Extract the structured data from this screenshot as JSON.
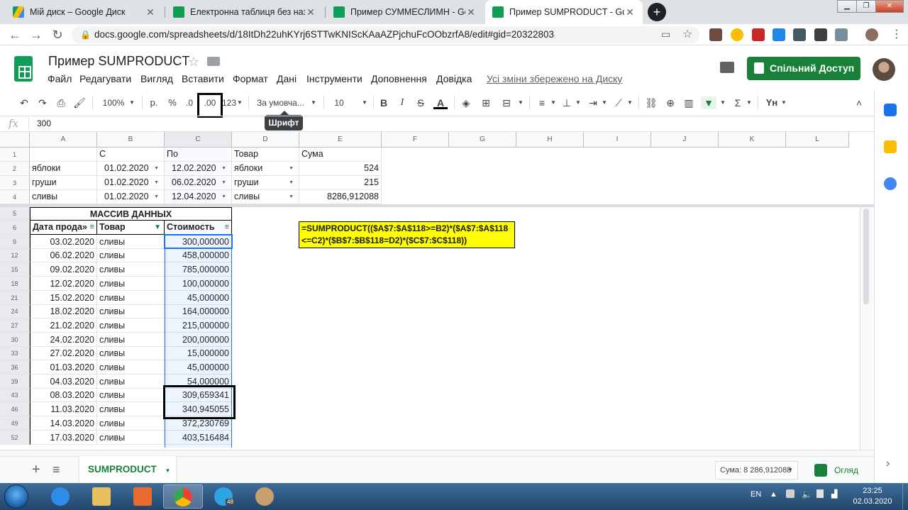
{
  "browser": {
    "tabs": [
      {
        "title": "Мій диск – Google Диск",
        "color": "#fbbc04"
      },
      {
        "title": "Електронна таблиця без назви",
        "color": "#0f9d58"
      },
      {
        "title": "Пример СУММЕСЛИМН - Goog",
        "color": "#0f9d58"
      },
      {
        "title": "Пример SUMPRODUCT - Google",
        "color": "#0f9d58"
      }
    ],
    "new_tab": "+",
    "url": "docs.google.com/spreadsheets/d/18ItDh22uhKYrj6STTwKNIScKAaAZPjchuFcOObzrfA8/edit#gid=20322803"
  },
  "sheets": {
    "title": "Пример SUMPRODUCT",
    "menu": [
      "Файл",
      "Редагувати",
      "Вигляд",
      "Вставити",
      "Формат",
      "Дані",
      "Інструменти",
      "Доповнення",
      "Довідка"
    ],
    "saved_message": "Усі зміни збережено на Диску",
    "share_label": "Спільний Доступ"
  },
  "toolbar": {
    "zoom": "100%",
    "currency": "р.",
    "percent": "%",
    "dec_decrease": ".0",
    "dec_increase": ".00",
    "more_formats": "123",
    "font": "За умовча...",
    "font_size": "10",
    "bold": "B",
    "italic": "I",
    "strike": "S",
    "text_color": "A",
    "tooltip": "Шрифт"
  },
  "formula_bar": {
    "fx": "fx",
    "value": "300"
  },
  "columns": [
    "A",
    "B",
    "C",
    "D",
    "E",
    "F",
    "G",
    "H",
    "I",
    "J",
    "K",
    "L"
  ],
  "criteria": {
    "header": {
      "c": "С",
      "po": "По",
      "tovar": "Товар",
      "suma": "Сума"
    },
    "rows": [
      {
        "row": "2",
        "name": "яблоки",
        "from": "01.02.2020",
        "to": "12.02.2020",
        "product": "яблоки",
        "sum": "524"
      },
      {
        "row": "3",
        "name": "груши",
        "from": "01.02.2020",
        "to": "06.02.2020",
        "product": "груши",
        "sum": "215"
      },
      {
        "row": "4",
        "name": "сливы",
        "from": "01.02.2020",
        "to": "12.04.2020",
        "product": "сливы",
        "sum": "8286,912088"
      }
    ]
  },
  "dataset": {
    "title": "МАССИВ ДАННЫХ",
    "headers": {
      "date": "Дата прода»",
      "product": "Товар",
      "cost": "Стоимость"
    },
    "rows": [
      {
        "row": "9",
        "date": "03.02.2020",
        "product": "сливы",
        "cost": "300,000000"
      },
      {
        "row": "12",
        "date": "06.02.2020",
        "product": "сливы",
        "cost": "458,000000"
      },
      {
        "row": "15",
        "date": "09.02.2020",
        "product": "сливы",
        "cost": "785,000000"
      },
      {
        "row": "18",
        "date": "12.02.2020",
        "product": "сливы",
        "cost": "100,000000"
      },
      {
        "row": "21",
        "date": "15.02.2020",
        "product": "сливы",
        "cost": "45,000000"
      },
      {
        "row": "24",
        "date": "18.02.2020",
        "product": "сливы",
        "cost": "164,000000"
      },
      {
        "row": "27",
        "date": "21.02.2020",
        "product": "сливы",
        "cost": "215,000000"
      },
      {
        "row": "30",
        "date": "24.02.2020",
        "product": "сливы",
        "cost": "200,000000"
      },
      {
        "row": "33",
        "date": "27.02.2020",
        "product": "сливы",
        "cost": "15,000000"
      },
      {
        "row": "36",
        "date": "01.03.2020",
        "product": "сливы",
        "cost": "45,000000"
      },
      {
        "row": "39",
        "date": "04.03.2020",
        "product": "сливы",
        "cost": "54,000000"
      },
      {
        "row": "43",
        "date": "08.03.2020",
        "product": "сливы",
        "cost": "309,659341"
      },
      {
        "row": "46",
        "date": "11.03.2020",
        "product": "сливы",
        "cost": "340,945055"
      },
      {
        "row": "49",
        "date": "14.03.2020",
        "product": "сливы",
        "cost": "372,230769"
      },
      {
        "row": "52",
        "date": "17.03.2020",
        "product": "сливы",
        "cost": "403,516484"
      }
    ]
  },
  "formula_note": {
    "line1": "=SUMPRODUCT(($A$7:$A$118>=B2)*($A$7:$A$118",
    "line2": "<=C2)*($B$7:$B$118=D2)*($C$7:$C$118))"
  },
  "bottom": {
    "add": "+",
    "all_sheets": "≡",
    "sheet_tab": "SUMPRODUCT",
    "sum_status": "Сума: 8 286,912088",
    "explore": "Огляд"
  },
  "taskbar": {
    "lang": "EN",
    "time": "23:25",
    "date": "02.03.2020",
    "telegram_badge": "48"
  }
}
